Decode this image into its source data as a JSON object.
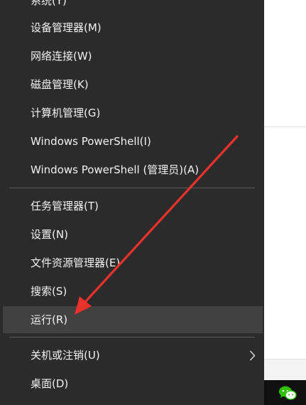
{
  "menu": {
    "items": [
      {
        "label": "系统(Y)"
      },
      {
        "label": "设备管理器(M)"
      },
      {
        "label": "网络连接(W)"
      },
      {
        "label": "磁盘管理(K)"
      },
      {
        "label": "计算机管理(G)"
      },
      {
        "label": "Windows PowerShell(I)"
      },
      {
        "label": "Windows PowerShell (管理员)(A)"
      },
      {
        "label": "任务管理器(T)"
      },
      {
        "label": "设置(N)"
      },
      {
        "label": "文件资源管理器(E)"
      },
      {
        "label": "搜索(S)"
      },
      {
        "label": "运行(R)",
        "highlighted": true
      },
      {
        "label": "关机或注销(U)",
        "has_submenu": true
      },
      {
        "label": "桌面(D)"
      }
    ]
  },
  "colors": {
    "menu_bg": "#2b2b2b",
    "highlight_bg": "#414141",
    "annotation_arrow": "#e8322b"
  },
  "icons": {
    "submenu": "chevron-right-icon",
    "taskbar": "wechat-icon"
  }
}
